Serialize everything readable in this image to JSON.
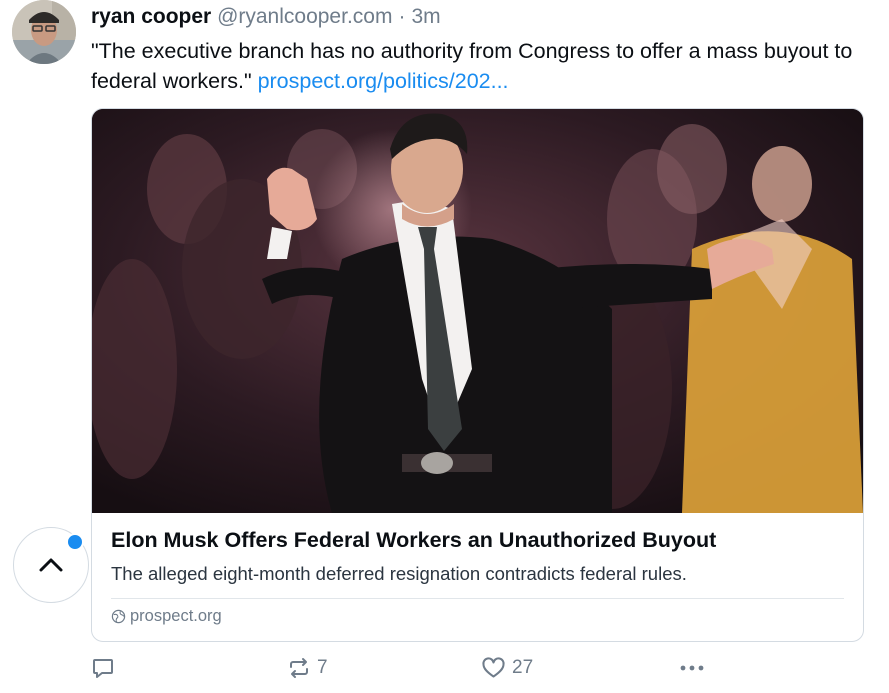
{
  "author": {
    "name": "ryan cooper",
    "handle": "@ryanlcooper.com",
    "separator": "·",
    "time": "3m"
  },
  "post": {
    "text": "\"The executive branch has no authority from Congress to offer a mass buyout to federal workers.\" ",
    "link": "prospect.org/politics/202..."
  },
  "card": {
    "title": "Elon Musk Offers Federal Workers an Unauthorized Buyout",
    "description": "The alleged eight-month deferred resignation contradicts federal rules.",
    "domain": "prospect.org"
  },
  "actions": {
    "reply_count": "",
    "repost_count": "7",
    "like_count": "27"
  },
  "icons": {
    "reply": "reply-icon",
    "repost": "repost-icon",
    "like": "heart-icon",
    "more": "more-icon",
    "globe": "globe-icon",
    "scroll_top": "chevron-up-icon"
  },
  "colors": {
    "link": "#1a8cf0",
    "muted": "#6f7c8a",
    "notification": "#1a8cf0"
  }
}
